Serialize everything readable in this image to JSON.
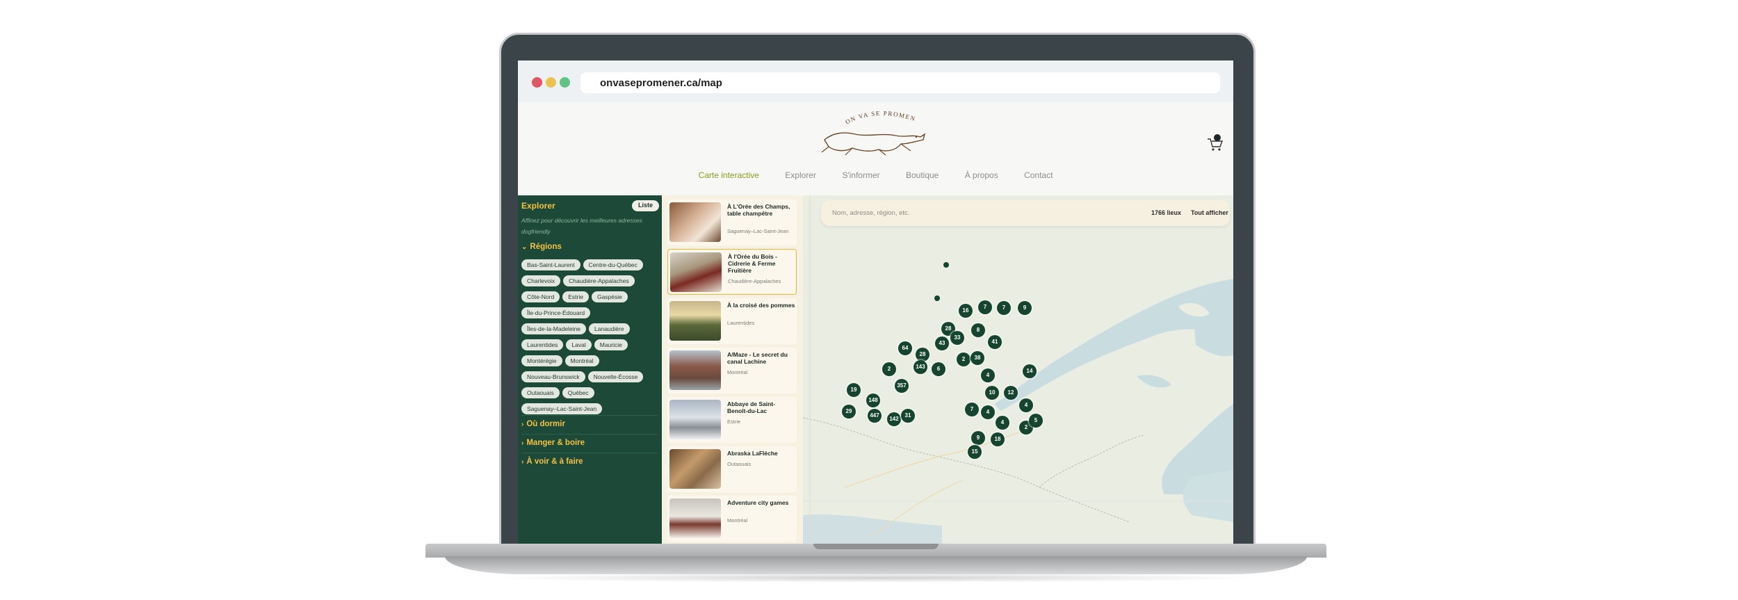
{
  "browser": {
    "url": "onvasepromener.ca/map"
  },
  "header": {
    "logo_text": "ON VA SE PROMENER",
    "nav": [
      {
        "label": "Carte interactive",
        "active": true
      },
      {
        "label": "Explorer",
        "active": false
      },
      {
        "label": "S'informer",
        "active": false
      },
      {
        "label": "Boutique",
        "active": false
      },
      {
        "label": "À propos",
        "active": false
      },
      {
        "label": "Contact",
        "active": false
      }
    ]
  },
  "sidebar": {
    "title": "Explorer",
    "list_button": "Liste",
    "description": "Affinez pour découvrir les meilleures adresses dogfriendly",
    "regions_label": "Régions",
    "regions": [
      "Bas-Saint-Laurent",
      "Centre-du-Québec",
      "Charlevoix",
      "Chaudière-Appalaches",
      "Côte-Nord",
      "Estrie",
      "Gaspésie",
      "Île-du-Prince-Édouard",
      "Îles-de-la-Madeleine",
      "Lanaudière",
      "Laurentides",
      "Laval",
      "Mauricie",
      "Montérégie",
      "Montréal",
      "Nouveau-Brunswick",
      "Nouvelle-Écosse",
      "Outaouais",
      "Québec",
      "Saguenay–Lac-Saint-Jean"
    ],
    "sections": [
      "Où dormir",
      "Manger & boire",
      "À voir & à faire"
    ]
  },
  "listings": [
    {
      "title": "À L'Orée des Champs, table champêtre",
      "region": "Saguenay–Lac-Saint-Jean",
      "selected": false
    },
    {
      "title": "À l'Orée du Bois - Cidrerie & Ferme Fruitière",
      "region": "Chaudière-Appalaches",
      "selected": true
    },
    {
      "title": "À la croisé des pommes",
      "region": "Laurentides",
      "selected": false
    },
    {
      "title": "A/Maze - Le secret du canal Lachine",
      "region": "Montréal",
      "selected": false
    },
    {
      "title": "Abbaye de Saint-Benoît-du-Lac",
      "region": "Estrie",
      "selected": false
    },
    {
      "title": "Abraska LaFlèche",
      "region": "Outaouais",
      "selected": false
    },
    {
      "title": "Adventure city games",
      "region": "Montréal",
      "selected": false
    }
  ],
  "map": {
    "search_placeholder": "Nom, adresse, région, etc.",
    "count_label": "1766 lieux",
    "show_all_label": "Tout afficher",
    "clusters": [
      "16",
      "7",
      "7",
      "9",
      "28",
      "8",
      "33",
      "43",
      "64",
      "41",
      "28",
      "2",
      "38",
      "2",
      "143",
      "6",
      "14",
      "4",
      "357",
      "19",
      "148",
      "10",
      "12",
      "447",
      "29",
      "142",
      "31",
      "7",
      "4",
      "4",
      "4",
      "2",
      "5",
      "9",
      "18",
      "15"
    ]
  },
  "colors": {
    "sidebar_bg": "#1d4a38",
    "accent_yellow": "#f3c23c",
    "nav_active": "#8c9a1d",
    "cluster": "#15452f",
    "selected_border": "#e7b73a"
  }
}
